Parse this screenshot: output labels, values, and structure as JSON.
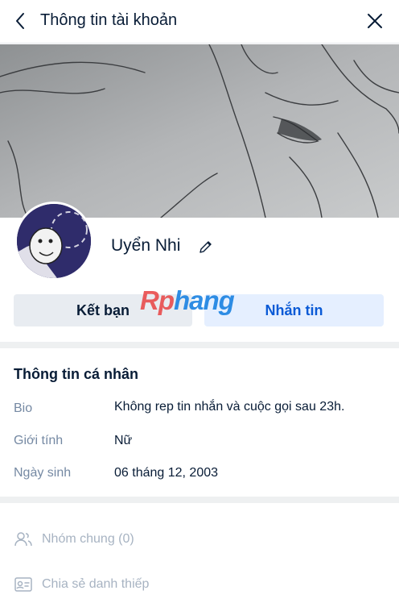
{
  "header": {
    "title": "Thông tin tài khoản"
  },
  "profile": {
    "name": "Uyển Nhi"
  },
  "buttons": {
    "add_friend": "Kết bạn",
    "message": "Nhắn tin"
  },
  "watermark": {
    "part1": "Rp",
    "part2": "hang"
  },
  "personal": {
    "title": "Thông tin cá nhân",
    "rows": [
      {
        "label": "Bio",
        "value": "Không rep tin nhắn và cuộc gọi sau 23h."
      },
      {
        "label": "Giới tính",
        "value": "Nữ"
      },
      {
        "label": "Ngày sinh",
        "value": "06 tháng 12, 2003"
      }
    ]
  },
  "actions": [
    {
      "label": "Nhóm chung (0)",
      "icon": "group-icon"
    },
    {
      "label": "Chia sẻ danh thiếp",
      "icon": "contact-card-icon"
    }
  ]
}
